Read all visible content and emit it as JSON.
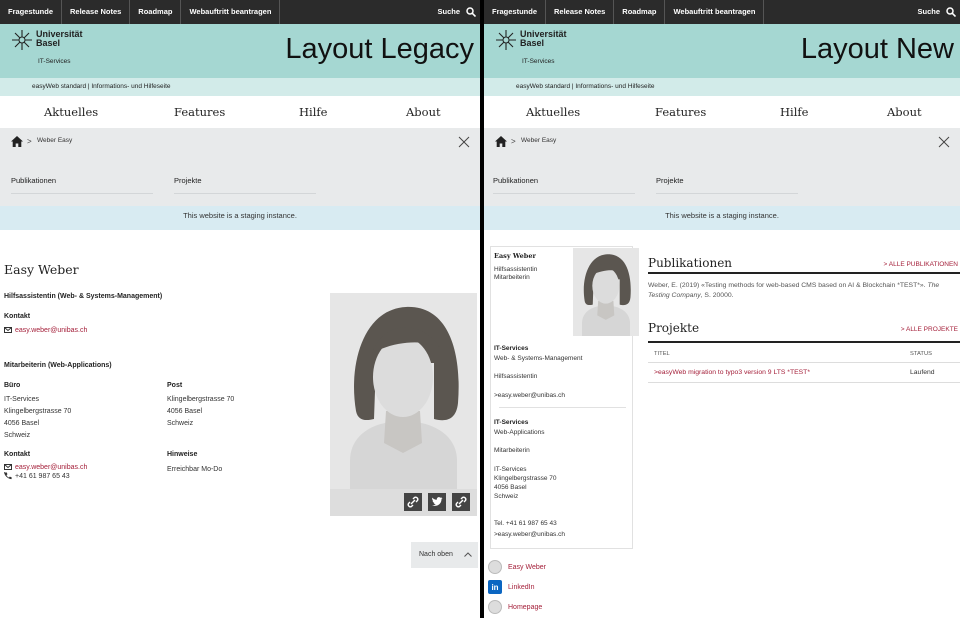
{
  "top_links": [
    "Fragestunde",
    "Release Notes",
    "Roadmap",
    "Webauftritt beantragen"
  ],
  "search_label": "Suche",
  "logo": {
    "line1": "Universität",
    "line2": "Basel"
  },
  "department": "IT-Services",
  "subtitle": "easyWeb standard | Informations- und Hilfeseite",
  "main_nav": [
    "Aktuelles",
    "Features",
    "Hilfe",
    "About"
  ],
  "breadcrumb": {
    "separator": ">",
    "current": "Weber Easy"
  },
  "sub_nav": [
    "Publikationen",
    "Projekte"
  ],
  "staging_notice": "This website is a staging instance.",
  "legacy": {
    "layout_label": "Layout Legacy",
    "name": "Easy Weber",
    "role1": "Hilfsassistentin (Web- & Systems-Management)",
    "contact_label": "Kontakt",
    "email": "easy.weber@unibas.ch",
    "role2": "Mitarbeiterin (Web-Applications)",
    "office_label": "Büro",
    "office_lines": [
      "IT-Services",
      "Klingelbergstrasse 70",
      "4056 Basel",
      "Schweiz"
    ],
    "post_label": "Post",
    "post_lines": [
      "Klingelbergstrasse 70",
      "4056 Basel",
      "Schweiz"
    ],
    "contact2_label": "Kontakt",
    "phone": "+41 61 987 65 43",
    "notes_label": "Hinweise",
    "notes": "Erreichbar Mo-Do",
    "back_to_top": "Nach oben"
  },
  "new": {
    "layout_label": "Layout New",
    "name": "Easy Weber",
    "card_role1": "Hilfsassistentin",
    "card_role2": "Mitarbeiterin",
    "org1": "IT-Services",
    "unit1": "Web- & Systems-Management",
    "role1": "Hilfsassistentin",
    "email1": ">easy.weber@unibas.ch",
    "org2": "IT-Services",
    "unit2": "Web-Applications",
    "role2": "Mitarbeiterin",
    "address_lines": [
      "IT-Services",
      "Klingelbergstrasse 70",
      "4056 Basel",
      "Schweiz"
    ],
    "phone": "Tel. +41 61 987 65 43",
    "email2": ">easy.weber@unibas.ch",
    "social": [
      "Easy Weber",
      "LinkedIn",
      "Homepage"
    ],
    "pub_heading": "Publikationen",
    "pub_all": "> ALLE PUBLIKATIONEN",
    "pub_text_main": "Weber, E. (2019) «Testing methods for web-based CMS based on AI & Blockchain *TEST*».",
    "pub_text_source": "The Testing Company",
    "pub_text_tail": ", S. 20000.",
    "proj_heading": "Projekte",
    "proj_all": "> ALLE PROJEKTE",
    "col_title": "TITEL",
    "col_status": "STATUS",
    "proj_title": ">easyWeb migration to typo3 version 9 LTS *TEST*",
    "proj_status": "Laufend"
  },
  "colors": {
    "mint": "#a5d7d2",
    "subbar": "#d2ebe9",
    "breadcrumb_bg": "#e8eaeb",
    "staging_bg": "#d8ebf2",
    "link": "#a5213b",
    "topbar": "#2b2b2b"
  },
  "icons": [
    "search-icon",
    "home-icon",
    "close-icon",
    "mail-icon",
    "phone-icon",
    "link-icon",
    "twitter-icon",
    "globe-icon",
    "linkedin-icon",
    "chevron-up-icon"
  ]
}
